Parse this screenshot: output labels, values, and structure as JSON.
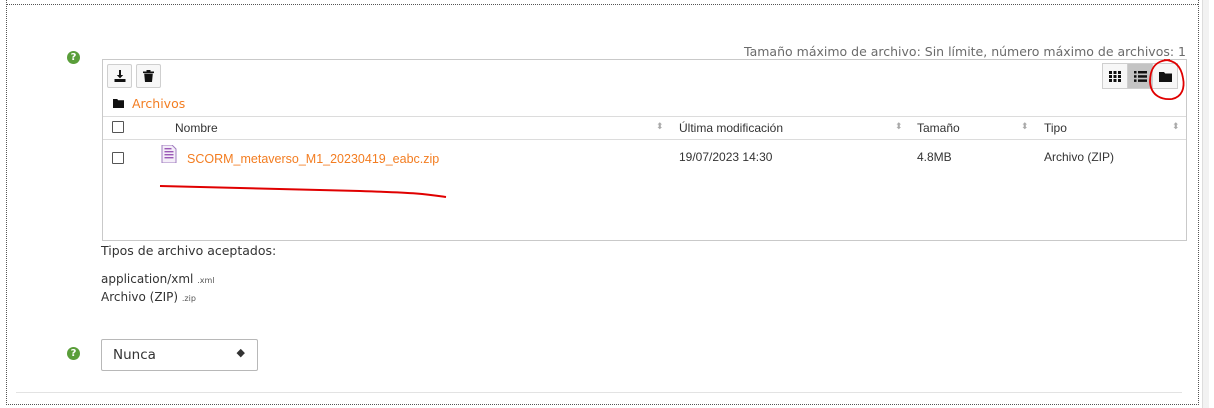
{
  "file_picker": {
    "max_size_text": "Tamaño máximo de archivo: Sin límite, número máximo de archivos: 1",
    "toolbar": {
      "download_icon": "download-icon",
      "delete_icon": "trash-icon",
      "view_icons": [
        "grid-icon",
        "list-icon",
        "folder-icon"
      ],
      "active_view": "list"
    },
    "breadcrumb": {
      "label": "Archivos"
    },
    "columns": {
      "name": "Nombre",
      "modified": "Última modificación",
      "size": "Tamaño",
      "type": "Tipo"
    },
    "files": [
      {
        "name": "SCORM_metaverso_M1_20230419_eabc.zip",
        "modified": "19/07/2023 14:30",
        "size": "4.8MB",
        "type": "Archivo (ZIP)"
      }
    ]
  },
  "accepted": {
    "label": "Tipos de archivo aceptados:",
    "types": [
      {
        "name": "application/xml",
        "ext": ".xml"
      },
      {
        "name": "Archivo (ZIP)",
        "ext": ".zip"
      }
    ]
  },
  "frequency_select": {
    "value": "Nunca",
    "arrow": "◆"
  },
  "colors": {
    "accent": "#f37d21",
    "help": "#5a9e3a",
    "annotation": "#e00000"
  }
}
